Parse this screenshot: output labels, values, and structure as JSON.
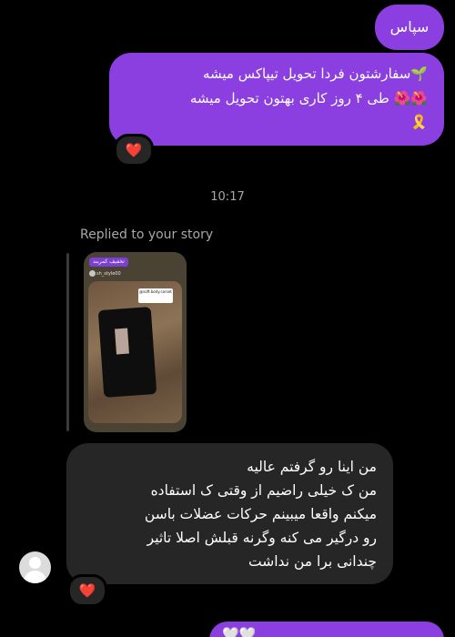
{
  "messages": {
    "outgoing_thanks": "سپاس",
    "outgoing_order_line1": "🌱سفارشتون فردا تحویل تیپاکس میشه",
    "outgoing_order_line2": "🌺🌺 طی ۴ روز کاری بهتون تحویل میشه",
    "outgoing_order_ribbon": "🎗️",
    "reaction_1": "❤️",
    "timestamp": "10:17",
    "replied_label": "Replied to your story",
    "story": {
      "header": "تخفیف کمربند",
      "username": "sh_style00",
      "sticker": "@soft.body.corset"
    },
    "incoming_lines": [
      "من اینا رو گرفتم عالیه",
      "من ک خیلی راضیم از وقتی ک استفاده",
      "میکنم واقعا میبینم حرکات  عضلات باسن",
      "رو درگیر می کنه وگرنه قبلش اصلا تاثیر",
      "چندانی برا من نداشت"
    ],
    "reaction_2": "❤️",
    "partial_bottom": "🤍🤍"
  },
  "colors": {
    "background": "#000000",
    "outgoing_bubble": "#8b3fe0",
    "incoming_bubble": "#262626",
    "meta_text": "#a8a8a8"
  }
}
